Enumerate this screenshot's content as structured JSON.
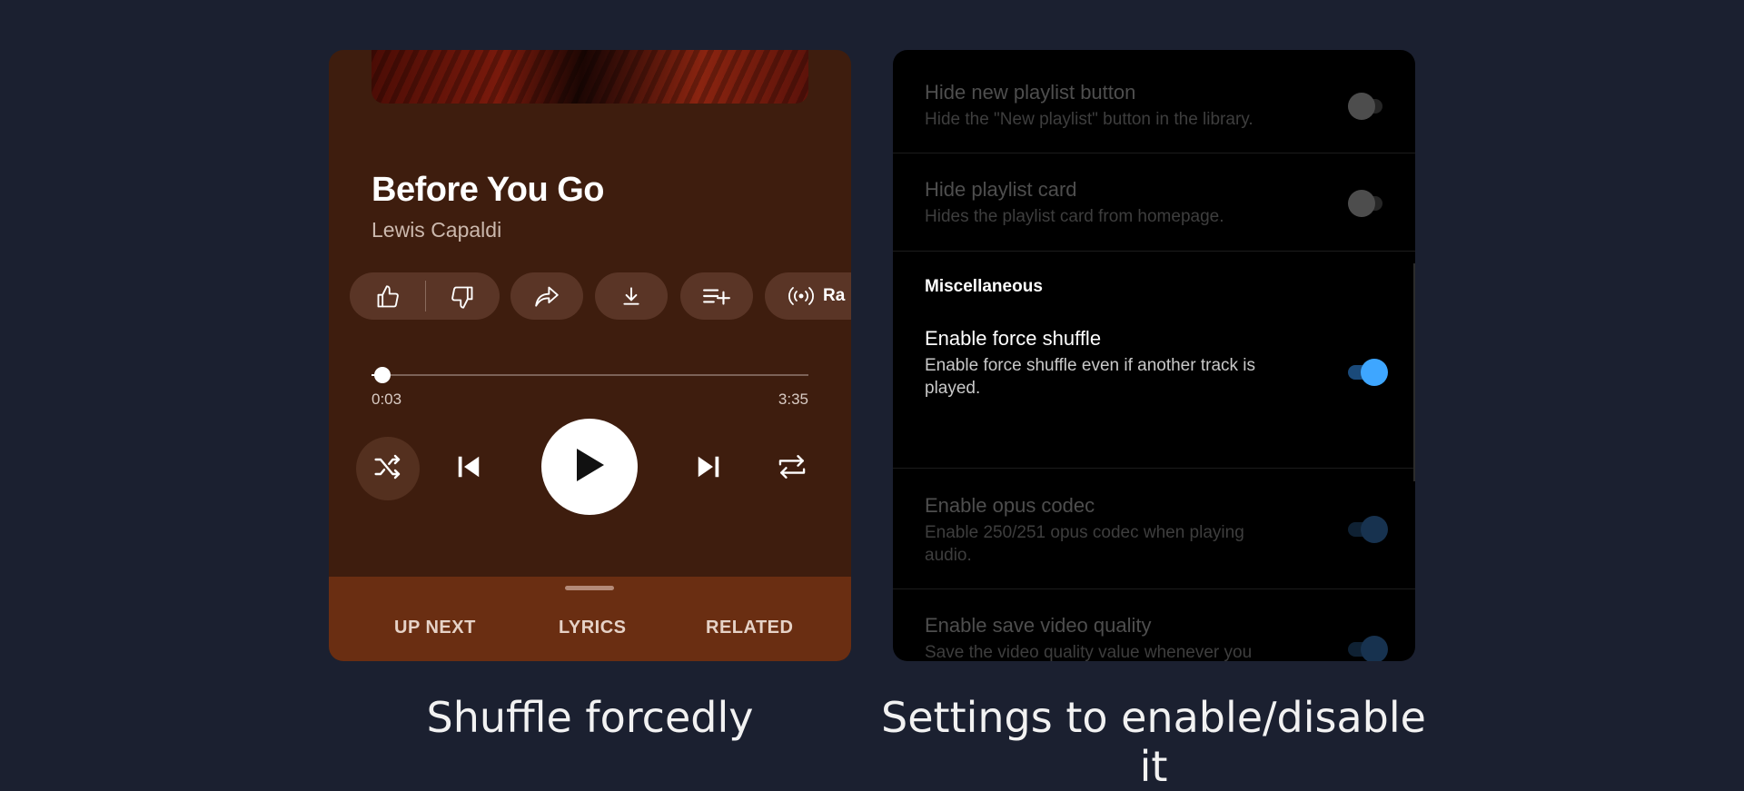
{
  "player": {
    "track_title": "Before You Go",
    "artist": "Lewis Capaldi",
    "actions": [
      {
        "icon": "thumbs-up-icon"
      },
      {
        "icon": "thumbs-down-icon"
      },
      {
        "icon": "share-icon"
      },
      {
        "icon": "download-icon"
      },
      {
        "icon": "add-to-playlist-icon"
      },
      {
        "icon": "radio-icon",
        "label": "Ra"
      }
    ],
    "radio_label": "Ra",
    "progress": 0.014,
    "time_current": "0:03",
    "time_total": "3:35",
    "tabs": {
      "up_next": "UP NEXT",
      "lyrics": "LYRICS",
      "related": "RELATED"
    }
  },
  "settings": {
    "rows": [
      {
        "title": "Hide new playlist button",
        "description": "Hide the \"New playlist\" button in the library.",
        "enabled": false,
        "available": false
      },
      {
        "title": "Hide playlist card",
        "description": "Hides the playlist card from homepage.",
        "enabled": false,
        "available": false
      },
      {
        "title": "Enable force shuffle",
        "description": "Enable force shuffle even if another track is played.",
        "enabled": true,
        "available": true
      },
      {
        "title": "Enable opus codec",
        "description": "Enable 250/251 opus codec when playing audio.",
        "enabled": true,
        "available": false
      },
      {
        "title": "Enable save video quality",
        "description": "Save the video quality value whenever you change the video quality.",
        "enabled": true,
        "available": false
      }
    ],
    "section_miscellaneous": "Miscellaneous"
  },
  "captions": {
    "left": "Shuffle forcedly",
    "right": "Settings to enable/disable it"
  },
  "colors": {
    "background": "#1b2030",
    "player_bg": "#3e1d0e",
    "sheet_bg": "#6a2e12",
    "toggle_on": "#3ea6ff",
    "toggle_on_track": "#1a4a7a"
  }
}
